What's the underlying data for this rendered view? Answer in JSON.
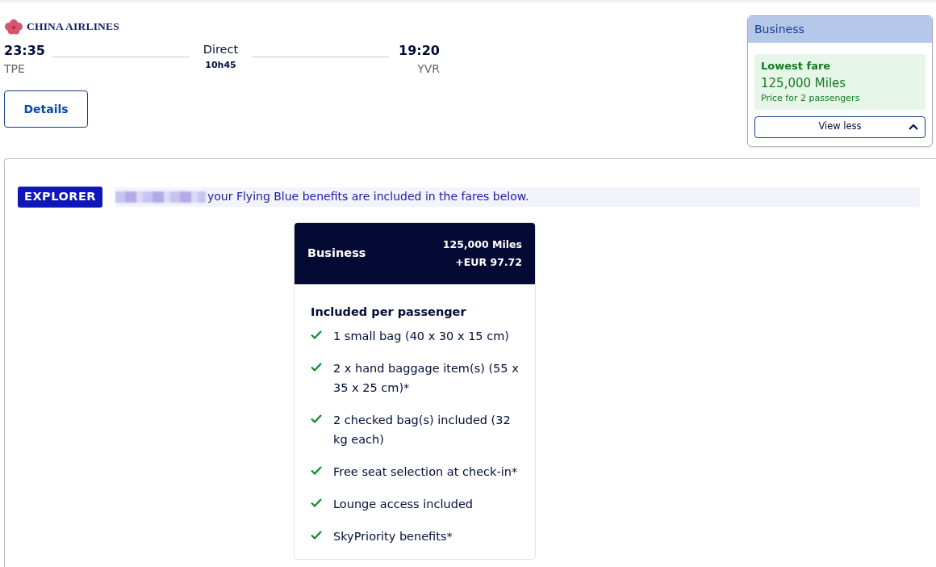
{
  "airline": {
    "name": "CHINA AIRLINES"
  },
  "flight": {
    "departure_time": "23:35",
    "departure_airport": "TPE",
    "stops": "Direct",
    "duration": "10h45",
    "arrival_time": "19:20",
    "arrival_airport": "YVR"
  },
  "details_button": "Details",
  "fare_summary": {
    "cabin": "Business",
    "badge": "Lowest fare",
    "price": "125,000 Miles",
    "note": "Price for 2 passengers",
    "toggle": "View less",
    "expanded": true
  },
  "loyalty": {
    "tier": "EXPLORER",
    "message": "your Flying Blue benefits are included in the fares below."
  },
  "fare_card": {
    "cabin": "Business",
    "miles": "125,000 Miles",
    "taxes": "+EUR 97.72",
    "heading": "Included per passenger",
    "benefits": [
      {
        "text": "1 small bag (40 x 30 x 15 cm)"
      },
      {
        "text": "2 x hand baggage item(s) (55 x 35 x 25 cm)*"
      },
      {
        "text": "2 checked bag(s) included (32 kg each)"
      },
      {
        "text": "Free seat selection at check-in*"
      },
      {
        "text": "Lounge access included"
      },
      {
        "text": "SkyPriority benefits*"
      }
    ]
  }
}
